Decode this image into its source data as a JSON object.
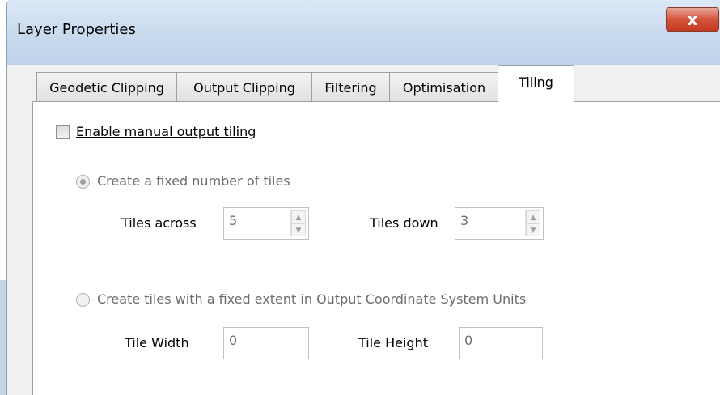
{
  "window": {
    "title": "Layer Properties",
    "close_label": "x"
  },
  "tabs": [
    {
      "label": "Geodetic Clipping"
    },
    {
      "label": "Output Clipping"
    },
    {
      "label": "Filtering"
    },
    {
      "label": "Optimisation"
    },
    {
      "label": "Tiling"
    }
  ],
  "active_tab": "Tiling",
  "tiling": {
    "enable_label": "Enable manual output tiling",
    "enable_checked": false,
    "fixed_number_label": "Create a fixed number of tiles",
    "fixed_number_selected": true,
    "tiles_across_label": "Tiles across",
    "tiles_across_value": "5",
    "tiles_down_label": "Tiles down",
    "tiles_down_value": "3",
    "fixed_extent_label": "Create tiles with a fixed extent in Output Coordinate System Units",
    "fixed_extent_selected": false,
    "tile_width_label": "Tile Width",
    "tile_width_value": "0",
    "tile_height_label": "Tile Height",
    "tile_height_value": "0"
  }
}
